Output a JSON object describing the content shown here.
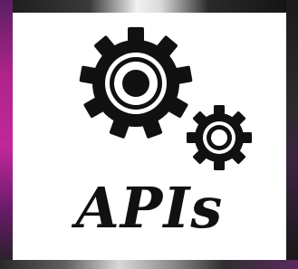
{
  "logo": {
    "title": "APIs",
    "icon_large": "gear-icon",
    "icon_small": "gear-icon",
    "colors": {
      "ink": "#111111",
      "card": "#ffffff",
      "accent_border": "#c1279a"
    }
  }
}
